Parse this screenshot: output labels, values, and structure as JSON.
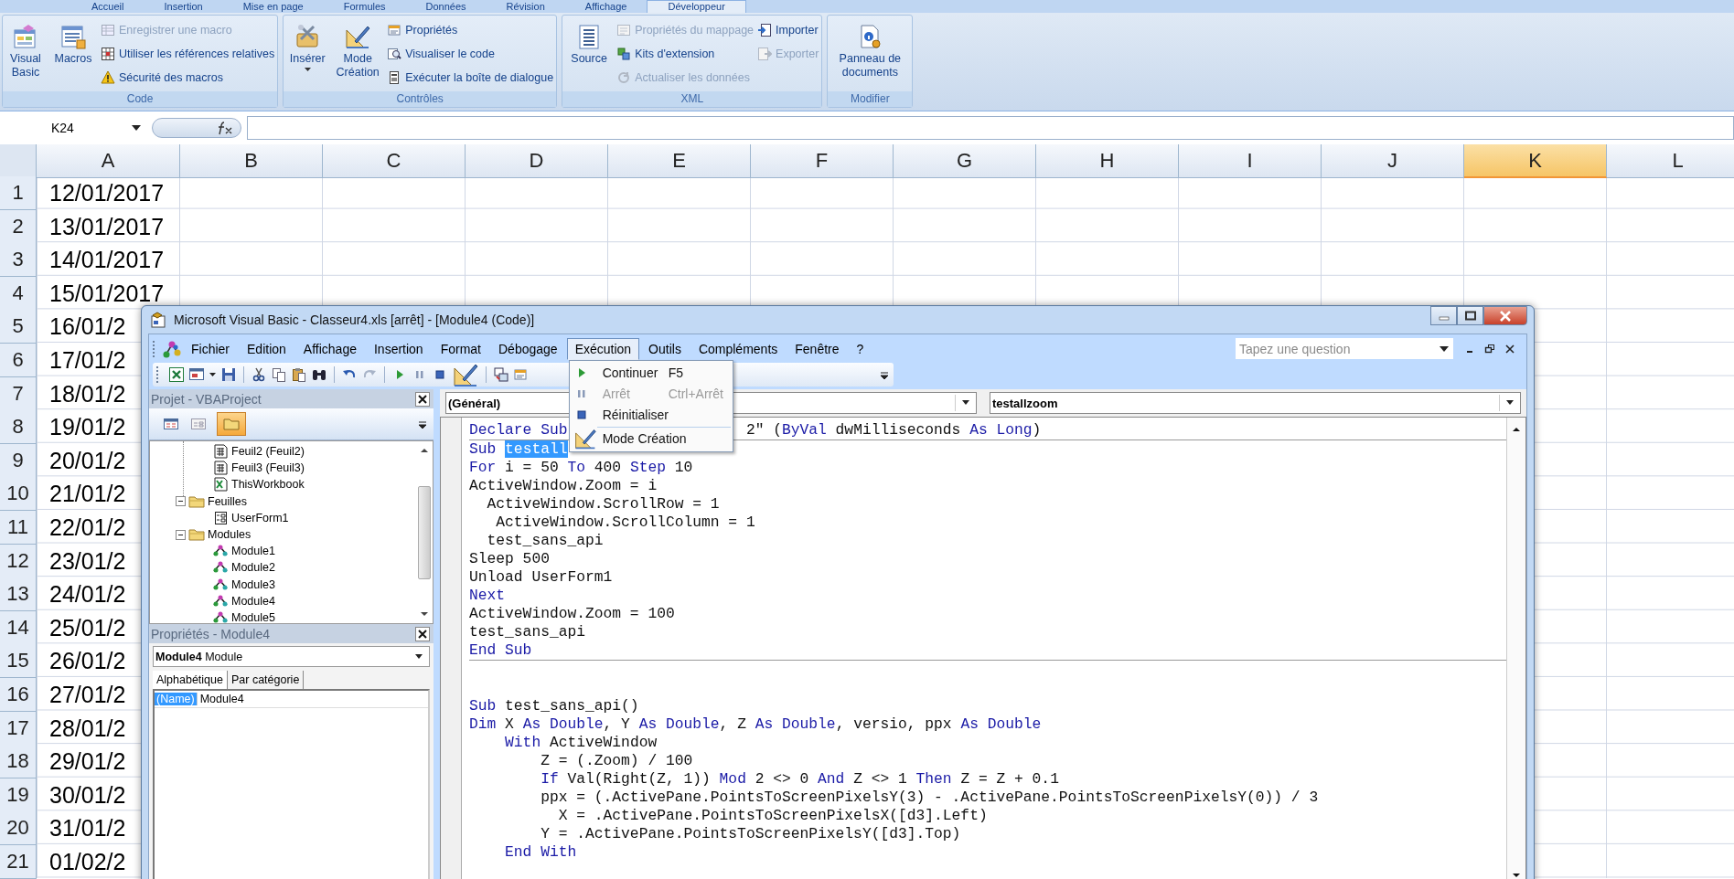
{
  "excel": {
    "ribbon_tabs": [
      {
        "label": "Accueil",
        "selected": false
      },
      {
        "label": "Insertion",
        "selected": false
      },
      {
        "label": "Mise en page",
        "selected": false
      },
      {
        "label": "Formules",
        "selected": false
      },
      {
        "label": "Données",
        "selected": false
      },
      {
        "label": "Révision",
        "selected": false
      },
      {
        "label": "Affichage",
        "selected": false
      },
      {
        "label": "Développeur",
        "selected": true
      }
    ],
    "ribbon_groups": [
      {
        "label": "Code",
        "large": [
          {
            "label": "Visual Basic"
          },
          {
            "label": "Macros"
          }
        ],
        "small_columns": [
          [
            {
              "label": "Enregistrer une macro",
              "disabled": true
            },
            {
              "label": "Utiliser les références relatives",
              "disabled": false
            },
            {
              "label": "Sécurité des macros",
              "disabled": false
            }
          ]
        ]
      },
      {
        "label": "Contrôles",
        "large": [
          {
            "label": "Insérer"
          },
          {
            "label": "Mode Création"
          }
        ],
        "small_columns": [
          [
            {
              "label": "Propriétés",
              "disabled": false
            },
            {
              "label": "Visualiser le code",
              "disabled": false
            },
            {
              "label": "Exécuter la boîte de dialogue",
              "disabled": false
            }
          ]
        ]
      },
      {
        "label": "XML",
        "large": [
          {
            "label": "Source"
          }
        ],
        "small_columns": [
          [
            {
              "label": "Propriétés du mappage",
              "disabled": true
            },
            {
              "label": "Kits d'extension",
              "disabled": false
            },
            {
              "label": "Actualiser les données",
              "disabled": true
            }
          ],
          [
            {
              "label": "Importer",
              "disabled": false
            },
            {
              "label": "Exporter",
              "disabled": true
            }
          ]
        ]
      },
      {
        "label": "Modifier",
        "large": [
          {
            "label": "Panneau de documents"
          }
        ]
      }
    ],
    "name_box": "K24",
    "columns": [
      {
        "label": "A",
        "selected": false
      },
      {
        "label": "B",
        "selected": false
      },
      {
        "label": "C",
        "selected": false
      },
      {
        "label": "D",
        "selected": false
      },
      {
        "label": "E",
        "selected": false
      },
      {
        "label": "F",
        "selected": false
      },
      {
        "label": "G",
        "selected": false
      },
      {
        "label": "H",
        "selected": false
      },
      {
        "label": "I",
        "selected": false
      },
      {
        "label": "J",
        "selected": false
      },
      {
        "label": "K",
        "selected": true
      },
      {
        "label": "L",
        "selected": false
      }
    ],
    "rows": [
      {
        "number": "1",
        "a": "12/01/2017"
      },
      {
        "number": "2",
        "a": "13/01/2017"
      },
      {
        "number": "3",
        "a": "14/01/2017"
      },
      {
        "number": "4",
        "a": "15/01/2017"
      },
      {
        "number": "5",
        "a": "16/01/2"
      },
      {
        "number": "6",
        "a": "17/01/2"
      },
      {
        "number": "7",
        "a": "18/01/2"
      },
      {
        "number": "8",
        "a": "19/01/2"
      },
      {
        "number": "9",
        "a": "20/01/2"
      },
      {
        "number": "10",
        "a": "21/01/2"
      },
      {
        "number": "11",
        "a": "22/01/2"
      },
      {
        "number": "12",
        "a": "23/01/2"
      },
      {
        "number": "13",
        "a": "24/01/2"
      },
      {
        "number": "14",
        "a": "25/01/2"
      },
      {
        "number": "15",
        "a": "26/01/2"
      },
      {
        "number": "16",
        "a": "27/01/2"
      },
      {
        "number": "17",
        "a": "28/01/2"
      },
      {
        "number": "18",
        "a": "29/01/2"
      },
      {
        "number": "19",
        "a": "30/01/2"
      },
      {
        "number": "20",
        "a": "31/01/2"
      },
      {
        "number": "21",
        "a": "01/02/2"
      }
    ]
  },
  "vbe": {
    "title": "Microsoft Visual Basic - Classeur4.xls [arrêt] - [Module4 (Code)]",
    "menu": [
      {
        "label": "Fichier",
        "selected": false
      },
      {
        "label": "Edition",
        "selected": false
      },
      {
        "label": "Affichage",
        "selected": false
      },
      {
        "label": "Insertion",
        "selected": false
      },
      {
        "label": "Format",
        "selected": false
      },
      {
        "label": "Débogage",
        "selected": false
      },
      {
        "label": "Exécution",
        "selected": true
      },
      {
        "label": "Outils",
        "selected": false
      },
      {
        "label": "Compléments",
        "selected": false
      },
      {
        "label": "Fenêtre",
        "selected": false
      },
      {
        "label": "?",
        "selected": false
      }
    ],
    "question_box": {
      "placeholder": "Tapez une question"
    },
    "open_menu": [
      {
        "label": "Continuer",
        "shortcut": "F5",
        "disabled": false,
        "separator_before": false
      },
      {
        "label": "Arrêt",
        "shortcut": "Ctrl+Arrêt",
        "disabled": true,
        "separator_before": false
      },
      {
        "label": "Réinitialiser",
        "disabled": false,
        "separator_before": false
      },
      {
        "label": "Mode Création",
        "disabled": false,
        "separator_before": true
      }
    ],
    "project": {
      "title": "Projet - VBAProject",
      "tree": [
        {
          "children": [
            {
              "label": "Feuil2 (Feuil2)",
              "kind": "sheet"
            },
            {
              "label": "Feuil3 (Feuil3)",
              "kind": "sheet"
            },
            {
              "label": "ThisWorkbook",
              "kind": "workbook"
            }
          ]
        },
        {
          "label": "Feuilles",
          "kind": "folder",
          "expanded": true,
          "children": [
            {
              "label": "UserForm1",
              "kind": "form"
            }
          ]
        },
        {
          "label": "Modules",
          "kind": "folder",
          "expanded": true,
          "children": [
            {
              "label": "Module1",
              "kind": "module"
            },
            {
              "label": "Module2",
              "kind": "module"
            },
            {
              "label": "Module3",
              "kind": "module"
            },
            {
              "label": "Module4",
              "kind": "module"
            },
            {
              "label": "Module5",
              "kind": "module"
            }
          ]
        }
      ]
    },
    "properties": {
      "title": "Propriétés - Module4",
      "object": "Module4",
      "object_type": "Module",
      "tabs": [
        {
          "label": "Alphabétique",
          "selected": true
        },
        {
          "label": "Par catégorie",
          "selected": false
        }
      ],
      "rows": [
        {
          "name": "(Name)",
          "value": "Module4",
          "selected": true
        }
      ]
    },
    "code": {
      "object": "(Général)",
      "procedure": "testallzoom",
      "sections": [
        {
          "lines": [
            {
              "segments": [
                {
                  "kind": "keyword",
                  "text": "Declare Sub"
                }
              ],
              "after_menu": [
                {
                  "kind": "plain",
                  "text": "2\" ("
                },
                {
                  "kind": "keyword",
                  "text": "ByVal"
                },
                {
                  "kind": "plain",
                  "text": " dwMilliseconds "
                },
                {
                  "kind": "keyword",
                  "text": "As Long"
                },
                {
                  "kind": "plain",
                  "text": ")"
                }
              ]
            }
          ]
        },
        {
          "lines": [
            {
              "segments": [
                {
                  "kind": "keyword",
                  "text": "Sub "
                },
                {
                  "kind": "selection",
                  "text": "testall"
                }
              ]
            },
            {
              "segments": [
                {
                  "kind": "keyword",
                  "text": "For"
                },
                {
                  "kind": "plain",
                  "text": " i = 50 "
                },
                {
                  "kind": "keyword",
                  "text": "To"
                },
                {
                  "kind": "plain",
                  "text": " 400 "
                },
                {
                  "kind": "keyword",
                  "text": "Step"
                },
                {
                  "kind": "plain",
                  "text": " 10"
                }
              ]
            },
            {
              "segments": [
                {
                  "kind": "plain",
                  "text": "ActiveWindow.Zoom = i"
                }
              ]
            },
            {
              "segments": [
                {
                  "kind": "plain",
                  "text": "  ActiveWindow.ScrollRow = 1"
                }
              ]
            },
            {
              "segments": [
                {
                  "kind": "plain",
                  "text": "   ActiveWindow.ScrollColumn = 1"
                }
              ]
            },
            {
              "segments": [
                {
                  "kind": "plain",
                  "text": "  test_sans_api"
                }
              ]
            },
            {
              "segments": [
                {
                  "kind": "plain",
                  "text": "Sleep 500"
                }
              ]
            },
            {
              "segments": [
                {
                  "kind": "plain",
                  "text": "Unload UserForm1"
                }
              ]
            },
            {
              "segments": [
                {
                  "kind": "keyword",
                  "text": "Next"
                }
              ]
            },
            {
              "segments": [
                {
                  "kind": "plain",
                  "text": "ActiveWindow.Zoom = 100"
                }
              ]
            },
            {
              "segments": [
                {
                  "kind": "plain",
                  "text": "test_sans_api"
                }
              ]
            },
            {
              "segments": [
                {
                  "kind": "keyword",
                  "text": "End Sub"
                }
              ]
            }
          ]
        },
        {
          "lines": [
            {
              "segments": [
                {
                  "kind": "keyword",
                  "text": "Sub"
                },
                {
                  "kind": "plain",
                  "text": " test_sans_api()"
                }
              ]
            },
            {
              "segments": [
                {
                  "kind": "keyword",
                  "text": "Dim"
                },
                {
                  "kind": "plain",
                  "text": " X "
                },
                {
                  "kind": "keyword",
                  "text": "As Double"
                },
                {
                  "kind": "plain",
                  "text": ", Y "
                },
                {
                  "kind": "keyword",
                  "text": "As Double"
                },
                {
                  "kind": "plain",
                  "text": ", Z "
                },
                {
                  "kind": "keyword",
                  "text": "As Double"
                },
                {
                  "kind": "plain",
                  "text": ", versio, ppx "
                },
                {
                  "kind": "keyword",
                  "text": "As Double"
                }
              ]
            },
            {
              "segments": [
                {
                  "kind": "keyword",
                  "text": "    With"
                },
                {
                  "kind": "plain",
                  "text": " ActiveWindow"
                }
              ]
            },
            {
              "segments": [
                {
                  "kind": "plain",
                  "text": "        Z = (.Zoom) / 100"
                }
              ]
            },
            {
              "segments": [
                {
                  "kind": "keyword",
                  "text": "        If"
                },
                {
                  "kind": "plain",
                  "text": " Val(Right(Z, 1)) "
                },
                {
                  "kind": "keyword",
                  "text": "Mod"
                },
                {
                  "kind": "plain",
                  "text": " 2 <> 0 "
                },
                {
                  "kind": "keyword",
                  "text": "And"
                },
                {
                  "kind": "plain",
                  "text": " Z <> 1 "
                },
                {
                  "kind": "keyword",
                  "text": "Then"
                },
                {
                  "kind": "plain",
                  "text": " Z = Z + 0.1"
                }
              ]
            },
            {
              "segments": [
                {
                  "kind": "plain",
                  "text": "        ppx = (.ActivePane.PointsToScreenPixelsY(3) - .ActivePane.PointsToScreenPixelsY(0)) / 3"
                }
              ]
            },
            {
              "segments": [
                {
                  "kind": "plain",
                  "text": "          X = .ActivePane.PointsToScreenPixelsX([d3].Left)"
                }
              ]
            },
            {
              "segments": [
                {
                  "kind": "plain",
                  "text": "        Y = .ActivePane.PointsToScreenPixelsY([d3].Top)"
                }
              ]
            },
            {
              "segments": [
                {
                  "kind": "keyword",
                  "text": "    End With"
                }
              ]
            }
          ]
        }
      ]
    }
  }
}
